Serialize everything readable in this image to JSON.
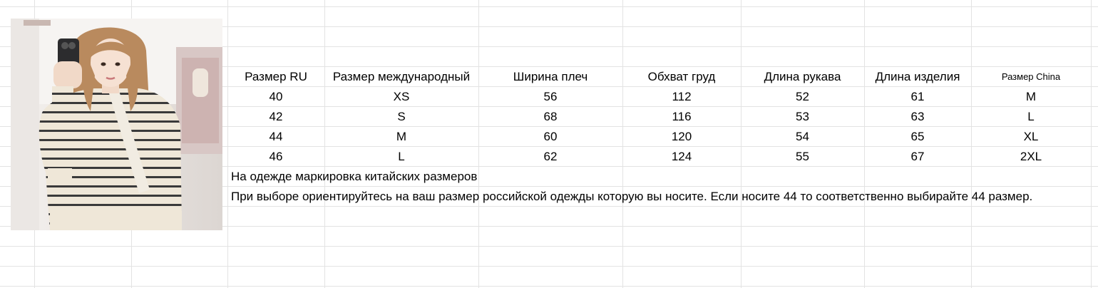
{
  "table": {
    "headers": [
      "Размер RU",
      "Размер международный",
      "Ширина плеч",
      "Обхват груд",
      "Длина рукава",
      "Длина изделия",
      "Размер China"
    ],
    "rows": [
      [
        "40",
        "XS",
        "56",
        "112",
        "52",
        "61",
        "M"
      ],
      [
        "42",
        "S",
        "68",
        "116",
        "53",
        "63",
        "L"
      ],
      [
        "44",
        "M",
        "60",
        "120",
        "54",
        "65",
        "XL"
      ],
      [
        "46",
        "L",
        "62",
        "124",
        "55",
        "67",
        "2XL"
      ]
    ]
  },
  "notes": {
    "line1": "На одежде маркировка китайских размеров",
    "line2": "При выборе ориентируйтесь на ваш размер российской одежды которую вы носите. Если носите 44 то соответственно выбирайте 44 размер."
  },
  "colors": {
    "grid": "#e3e3e3",
    "sweater": "#efe7d8",
    "stripe": "#3a3a3a",
    "hair": "#b98a5e"
  }
}
